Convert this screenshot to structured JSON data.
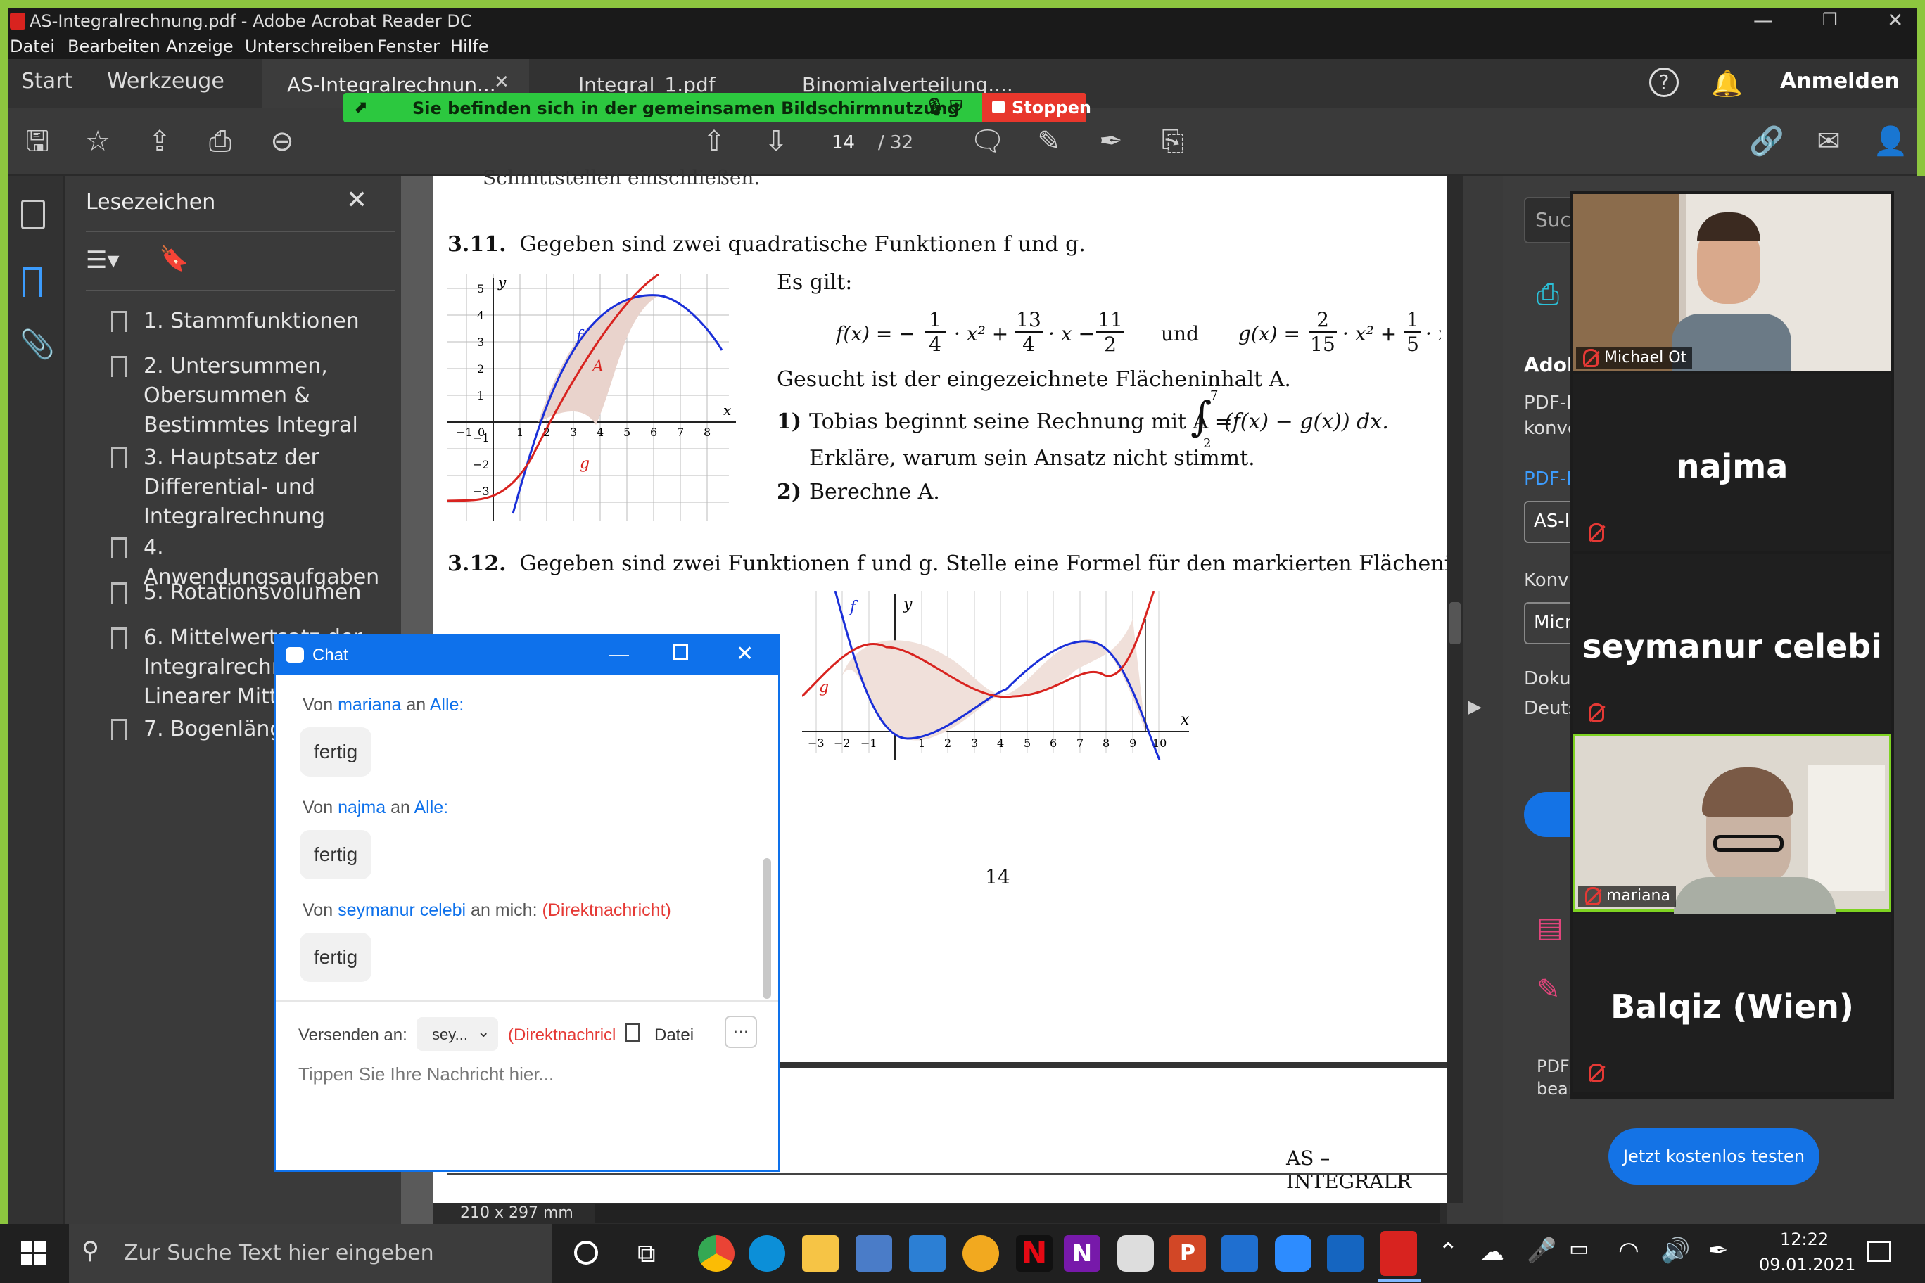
{
  "window": {
    "title": "AS-Integralrechnung.pdf - Adobe Acrobat Reader DC",
    "controls": {
      "minimize": "—",
      "restore": "❐",
      "close": "✕"
    }
  },
  "menu": [
    "Datei",
    "Bearbeiten",
    "Anzeige",
    "Unterschreiben",
    "Fenster",
    "Hilfe"
  ],
  "tabs": {
    "start": "Start",
    "tools": "Werkzeuge",
    "docs": [
      "AS-Integralrechnun...",
      "Integral_1.pdf",
      "Binomialverteilung...."
    ],
    "close": "✕",
    "signin": "Anmelden"
  },
  "share_banner": {
    "text": "Sie befinden sich in der gemeinsamen Bildschirmnutzung",
    "stop": "Stoppen"
  },
  "toolbar": {
    "page_current": "14",
    "page_total": "/ 32"
  },
  "bookmarks": {
    "title": "Lesezeichen",
    "items": [
      [
        "1. Stammfunktionen"
      ],
      [
        "2. Untersummen,",
        "Obersummen &",
        "Bestimmtes Integral"
      ],
      [
        "3. Hauptsatz der",
        "Differential- und",
        "Integralrechnung"
      ],
      [
        "4. Anwendungsaufgaben"
      ],
      [
        "5. Rotationsvolumen"
      ],
      [
        "6. Mittelwertsatz der",
        "Integralrechnung,",
        "Linearer Mittelwert"
      ],
      [
        "7. Bogenlänge"
      ]
    ]
  },
  "document": {
    "cut_line": "Schnittstellen einschließen.",
    "p311_label": "3.11.",
    "p311_text": "Gegeben sind zwei quadratische Funktionen f und g.",
    "es_gilt": "Es gilt:",
    "f_formula": "f(x) = −",
    "frac1": [
      "1",
      "4"
    ],
    "f_mid": "· x² +",
    "frac2": [
      "13",
      "4"
    ],
    "f_mid2": "· x −",
    "frac3": [
      "11",
      "2"
    ],
    "und": "und",
    "g_formula": "g(x) =",
    "frac4": [
      "2",
      "15"
    ],
    "g_mid": "· x² +",
    "frac5": [
      "1",
      "5"
    ],
    "g_mid2": "· x −",
    "gesucht": "Gesucht ist der eingezeichnete Flächeninhalt A.",
    "t1_num": "1)",
    "t1_text": "Tobias beginnt seine Rechnung mit A =",
    "t1_integral": "(f(x) − g(x)) dx.",
    "int_upper": "7",
    "int_lower": "2",
    "t1_text2": "Erkläre, warum sein Ansatz nicht stimmt.",
    "t2_num": "2)",
    "t2_text": "Berechne A.",
    "p312_label": "3.12.",
    "p312_text": "Gegeben sind zwei Funktionen f und g. Stelle eine Formel für den markierten Flächeninhalt auf.",
    "page_number": "14",
    "footer": "AS – INTEGRALR",
    "graph1": {
      "ylabel": "y",
      "xlabel": "x",
      "yticks": [
        "5",
        "4",
        "3",
        "2",
        "1",
        "−1",
        "−2",
        "−3"
      ],
      "xticks": [
        "−1",
        "0",
        "1",
        "2",
        "3",
        "4",
        "5",
        "6",
        "7",
        "8"
      ],
      "label_f": "f",
      "label_g": "g",
      "label_A": "A"
    },
    "graph2": {
      "ylabel": "y",
      "xlabel": "x",
      "xticks": [
        "−3",
        "−2",
        "−1",
        "1",
        "2",
        "3",
        "4",
        "5",
        "6",
        "7",
        "8",
        "9",
        "10"
      ],
      "label_f": "f",
      "label_g": "g"
    }
  },
  "statusbar": {
    "size": "210 x 297 mm"
  },
  "right_panel": {
    "search": "Suc",
    "adobe": "Adob",
    "pdf_line1": "PDF-D",
    "pdf_line2": "konve",
    "pdf_link": "PDF-D",
    "select1": "AS-I",
    "konv": "Konve",
    "select2": "Micr",
    "doku": "Doku",
    "deuts": "Deuts",
    "pdf_b1": "PDF",
    "pdf_b2": "bear",
    "trial_button": "Jetzt kostenlos testen"
  },
  "video": {
    "tiles": [
      {
        "type": "video",
        "name": "Michael Ot"
      },
      {
        "type": "name",
        "name": "najma"
      },
      {
        "type": "name",
        "name": "seymanur celebi"
      },
      {
        "type": "video",
        "name": "mariana"
      },
      {
        "type": "name",
        "name": "Balqiz (Wien)"
      }
    ]
  },
  "chat": {
    "title": "Chat",
    "messages": [
      {
        "von": "Von",
        "from": "mariana",
        "an": "an",
        "to": "Alle:",
        "direct": "",
        "text": "fertig"
      },
      {
        "von": "Von",
        "from": "najma",
        "an": "an",
        "to": "Alle:",
        "direct": "",
        "text": "fertig"
      },
      {
        "von": "Von",
        "from": "seymanur celebi",
        "an": "an mich:",
        "to": "",
        "direct": "(Direktnachricht)",
        "text": "fertig"
      }
    ],
    "send_to_label": "Versenden an:",
    "send_to_value": "sey...",
    "direct_hint": "(Direktnachricl",
    "file_label": "Datei",
    "more": "···",
    "placeholder": "Tippen Sie Ihre Nachricht hier..."
  },
  "taskbar": {
    "search_placeholder": "Zur Suche Text hier eingeben",
    "time": "12:22",
    "date": "09.01.2021"
  },
  "colors": {
    "accent_green": "#8dc63f",
    "zoom_blue": "#0e71eb",
    "share_green": "#2cc83f",
    "stop_red": "#e8372c",
    "curve_blue": "#1a2fd8",
    "curve_red": "#d8231f"
  }
}
